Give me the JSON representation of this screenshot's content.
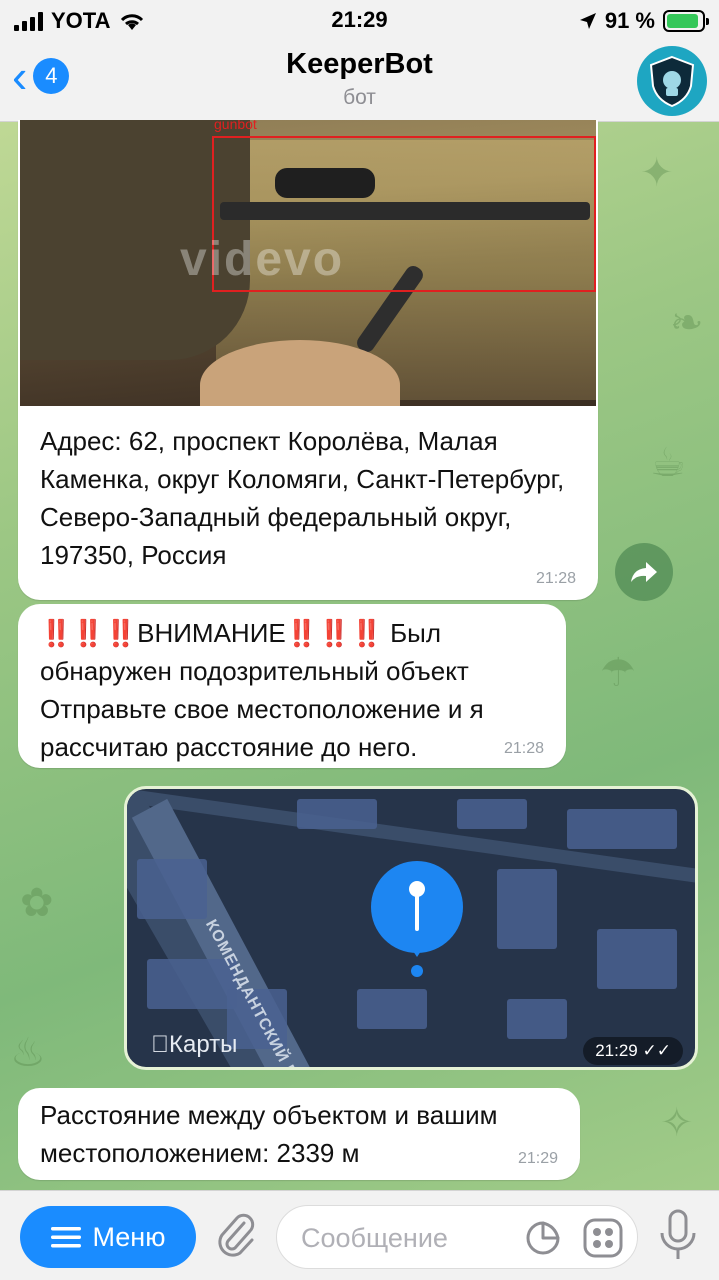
{
  "status": {
    "carrier": "YOTA",
    "time": "21:29",
    "battery_percent": "91 %",
    "battery_level": 0.91
  },
  "nav": {
    "back_count": "4",
    "title": "KeeperBot",
    "subtitle": "бот"
  },
  "messages": [
    {
      "detection_label": "gunbot",
      "watermark": "videvo",
      "text": "Адрес: 62, проспект Королёва, Малая Каменка, округ Коломяги, Санкт-Петербург, Северо-Западный федеральный округ, 197350, Россия",
      "time": "21:28"
    },
    {
      "alert_marks": "‼️‼️‼️",
      "alert_word": "ВНИМАНИЕ",
      "text": " Был обнаружен подозрительный объект Отправьте свое местоположение и я рассчитаю расстояние до него.",
      "time": "21:28"
    },
    {
      "map_street": "КОМЕНДАНТСКИЙ ПРОСПЕКТ",
      "map_brand": "Карты",
      "time": "21:29"
    },
    {
      "text": "Расстояние между объектом и вашим местоположением: 2339 м",
      "time": "21:29"
    }
  ],
  "input": {
    "menu_label": "Меню",
    "placeholder": "Сообщение"
  },
  "colors": {
    "accent": "#1a8cff",
    "alert": "#e0182d",
    "bot_avatar": "#1ea6c2"
  }
}
